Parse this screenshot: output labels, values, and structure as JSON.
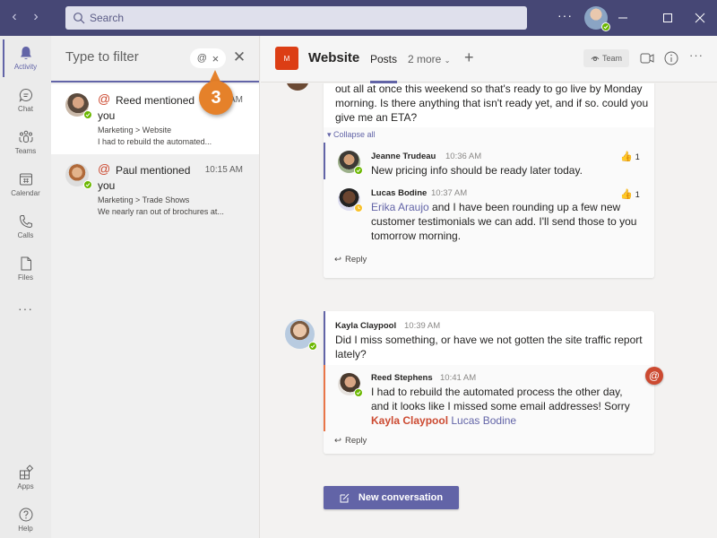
{
  "titlebar": {
    "search_placeholder": "Search",
    "more_label": "···",
    "status_color": "#6bb700"
  },
  "rail": {
    "items": [
      {
        "label": "Activity",
        "icon": "bell-icon",
        "active": true
      },
      {
        "label": "Chat",
        "icon": "chat-icon"
      },
      {
        "label": "Teams",
        "icon": "teams-icon"
      },
      {
        "label": "Calendar",
        "icon": "calendar-icon"
      },
      {
        "label": "Calls",
        "icon": "phone-icon"
      },
      {
        "label": "Files",
        "icon": "file-icon"
      }
    ],
    "more_label": "···",
    "bottom_items": [
      {
        "label": "Apps",
        "icon": "apps-icon"
      },
      {
        "label": "Help",
        "icon": "help-icon"
      }
    ]
  },
  "activity": {
    "filter_placeholder": "Type to filter",
    "filter_chip": "@",
    "feed": [
      {
        "at": "@",
        "title": "Reed mentioned",
        "time": "10:41 AM",
        "you": "you",
        "location": "Marketing > Website",
        "preview": "I had to rebuild the automated..."
      },
      {
        "at": "@",
        "title": "Paul mentioned",
        "time": "10:15 AM",
        "you": "you",
        "location": "Marketing > Trade Shows",
        "preview": "We nearly ran out of brochures at..."
      }
    ]
  },
  "callout": {
    "number": "3",
    "color": "#e5812a"
  },
  "channel": {
    "logo_letter": "M",
    "logo_color": "#dc3e15",
    "name": "Website",
    "tabs": {
      "posts": "Posts",
      "more": "2 more"
    },
    "add_tab": "+",
    "team_button": "Team"
  },
  "conversation": {
    "thread1": {
      "root_text": "out all at once this weekend so that's ready to go live by Monday morning. Is there anything that isn't ready yet, and if so. could you give me an ETA?",
      "collapse_label": "Collapse all",
      "replies": [
        {
          "author": "Jeanne Trudeau",
          "time": "10:36  AM",
          "text": "New pricing info should be ready later today.",
          "reaction_count": "1"
        },
        {
          "author": "Lucas Bodine",
          "time": "10:37 AM",
          "mention": "Erika Araujo",
          "text": " and I have been rounding up a few new customer testimonials we can add. I'll send those to you tomorrow morning.",
          "reaction_count": "1"
        }
      ],
      "reply_label": "Reply"
    },
    "thread2": {
      "author": "Kayla Claypool",
      "time": "10:39 AM",
      "text": "Did I miss something, or have we not gotten the site traffic report lately?",
      "reply": {
        "author": "Reed Stephens",
        "time": "10:41 AM",
        "text": "I had to rebuild the automated process the other day, and it looks like I missed some email addresses! Sorry ",
        "mention_me": "Kayla Claypool",
        "mention_other": "Lucas Bodine"
      },
      "reply_label": "Reply",
      "at_badge": "@"
    },
    "new_conversation_label": "New conversation"
  }
}
